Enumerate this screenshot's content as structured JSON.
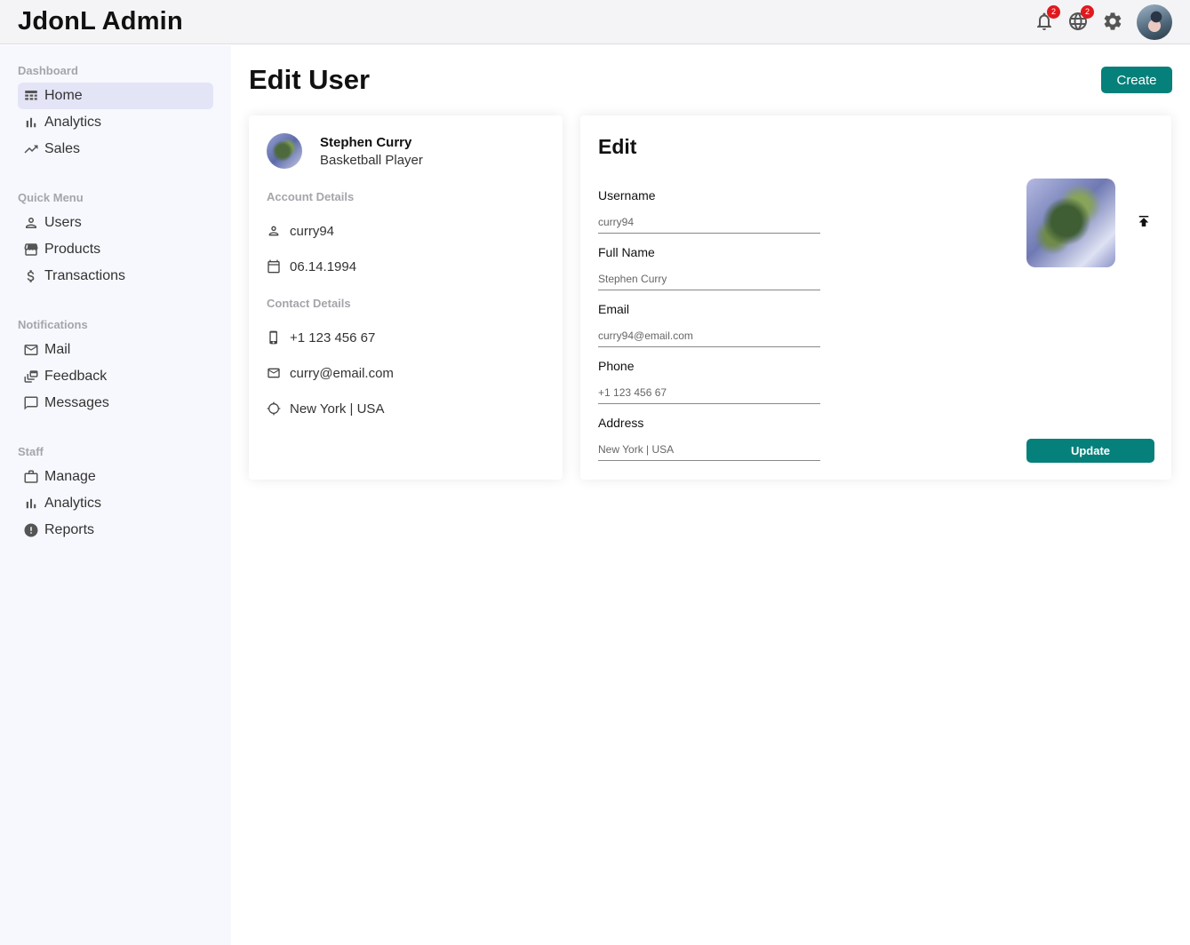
{
  "app": {
    "title": "JdonL Admin"
  },
  "topbar": {
    "notifications_badge": "2",
    "language_badge": "2"
  },
  "sidebar": {
    "sections": [
      {
        "title": "Dashboard",
        "items": [
          {
            "label": "Home",
            "icon": "dashboard-icon",
            "active": true
          },
          {
            "label": "Analytics",
            "icon": "bar-chart-icon"
          },
          {
            "label": "Sales",
            "icon": "trending-up-icon"
          }
        ]
      },
      {
        "title": "Quick Menu",
        "items": [
          {
            "label": "Users",
            "icon": "user-icon"
          },
          {
            "label": "Products",
            "icon": "storefront-icon"
          },
          {
            "label": "Transactions",
            "icon": "dollar-icon"
          }
        ]
      },
      {
        "title": "Notifications",
        "items": [
          {
            "label": "Mail",
            "icon": "mail-icon"
          },
          {
            "label": "Feedback",
            "icon": "dynamic-feed-icon"
          },
          {
            "label": "Messages",
            "icon": "chat-bubble-icon"
          }
        ]
      },
      {
        "title": "Staff",
        "items": [
          {
            "label": "Manage",
            "icon": "work-icon"
          },
          {
            "label": "Analytics",
            "icon": "bar-chart-icon"
          },
          {
            "label": "Reports",
            "icon": "report-icon"
          }
        ]
      }
    ]
  },
  "page": {
    "title": "Edit User",
    "create_label": "Create"
  },
  "user_show": {
    "name": "Stephen Curry",
    "job": "Basketball Player",
    "account_title": "Account Details",
    "username": "curry94",
    "birthday": "06.14.1994",
    "contact_title": "Contact Details",
    "phone": "+1 123 456 67",
    "email": "curry@email.com",
    "address": "New York | USA"
  },
  "user_edit": {
    "title": "Edit",
    "fields": [
      {
        "label": "Username",
        "placeholder": "curry94"
      },
      {
        "label": "Full Name",
        "placeholder": "Stephen Curry"
      },
      {
        "label": "Email",
        "placeholder": "curry94@email.com"
      },
      {
        "label": "Phone",
        "placeholder": "+1 123 456 67"
      },
      {
        "label": "Address",
        "placeholder": "New York | USA"
      }
    ],
    "update_label": "Update"
  },
  "colors": {
    "accent": "#06807a",
    "badge": "#e0191e",
    "sidebar_bg": "#f7f8fd",
    "active_item": "#e4e4f7"
  }
}
